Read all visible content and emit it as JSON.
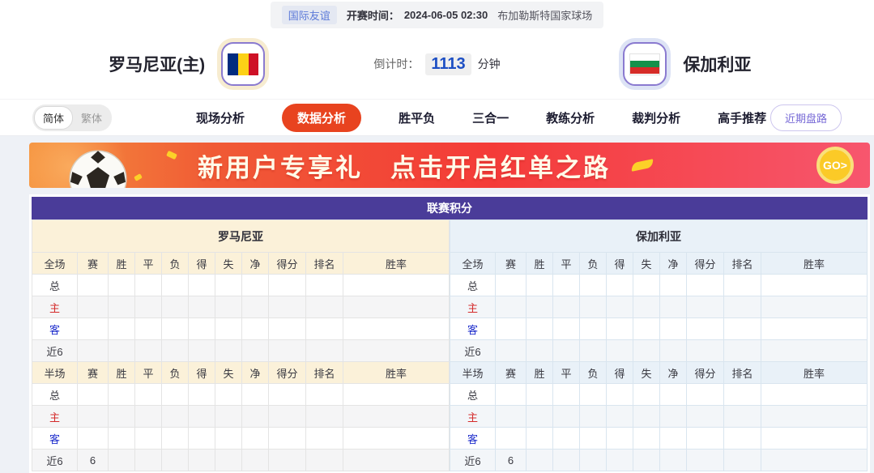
{
  "top_bar": {
    "league_badge": "国际友谊",
    "kickoff_label": "开赛时间：",
    "kickoff_time": "2024-06-05 02:30",
    "venue": "布加勒斯特国家球场"
  },
  "header": {
    "home_team": "罗马尼亚(主)",
    "away_team": "保加利亚",
    "home_flag_icon": "romania-flag-icon",
    "away_flag_icon": "bulgaria-flag-icon",
    "countdown_label": "倒计时：",
    "countdown_value": "1113",
    "countdown_unit": "分钟"
  },
  "nav": {
    "lang_simplified": "简体",
    "lang_traditional": "繁体",
    "tabs": [
      "现场分析",
      "数据分析",
      "胜平负",
      "三合一",
      "教练分析",
      "裁判分析",
      "高手推荐"
    ],
    "active_tab": "数据分析",
    "recent_trends_button": "近期盘路"
  },
  "banner": {
    "title_part1": "新用户专享礼",
    "title_part2": "点击开启红单之路",
    "go_label": "GO>",
    "ball_icon": "soccer-ball-icon"
  },
  "league_table": {
    "title": "联赛积分",
    "columns": [
      "赛",
      "胜",
      "平",
      "负",
      "得",
      "失",
      "净",
      "得分",
      "排名",
      "胜率"
    ],
    "halves": [
      {
        "team": "罗马尼亚",
        "theme": "home",
        "sections": [
          {
            "scope_label": "全场",
            "rows": [
              {
                "label": "总",
                "type": "total",
                "values": [
                  "",
                  "",
                  "",
                  "",
                  "",
                  "",
                  "",
                  "",
                  "",
                  ""
                ]
              },
              {
                "label": "主",
                "type": "home",
                "values": [
                  "",
                  "",
                  "",
                  "",
                  "",
                  "",
                  "",
                  "",
                  "",
                  ""
                ]
              },
              {
                "label": "客",
                "type": "away",
                "values": [
                  "",
                  "",
                  "",
                  "",
                  "",
                  "",
                  "",
                  "",
                  "",
                  ""
                ]
              },
              {
                "label": "近6",
                "type": "recent",
                "values": [
                  "",
                  "",
                  "",
                  "",
                  "",
                  "",
                  "",
                  "",
                  "",
                  ""
                ]
              }
            ]
          },
          {
            "scope_label": "半场",
            "rows": [
              {
                "label": "总",
                "type": "total",
                "values": [
                  "",
                  "",
                  "",
                  "",
                  "",
                  "",
                  "",
                  "",
                  "",
                  ""
                ]
              },
              {
                "label": "主",
                "type": "home",
                "values": [
                  "",
                  "",
                  "",
                  "",
                  "",
                  "",
                  "",
                  "",
                  "",
                  ""
                ]
              },
              {
                "label": "客",
                "type": "away",
                "values": [
                  "",
                  "",
                  "",
                  "",
                  "",
                  "",
                  "",
                  "",
                  "",
                  ""
                ]
              },
              {
                "label": "近6",
                "type": "recent",
                "values": [
                  "6",
                  "",
                  "",
                  "",
                  "",
                  "",
                  "",
                  "",
                  "",
                  ""
                ]
              }
            ]
          }
        ]
      },
      {
        "team": "保加利亚",
        "theme": "away",
        "sections": [
          {
            "scope_label": "全场",
            "rows": [
              {
                "label": "总",
                "type": "total",
                "values": [
                  "",
                  "",
                  "",
                  "",
                  "",
                  "",
                  "",
                  "",
                  "",
                  ""
                ]
              },
              {
                "label": "主",
                "type": "home",
                "values": [
                  "",
                  "",
                  "",
                  "",
                  "",
                  "",
                  "",
                  "",
                  "",
                  ""
                ]
              },
              {
                "label": "客",
                "type": "away",
                "values": [
                  "",
                  "",
                  "",
                  "",
                  "",
                  "",
                  "",
                  "",
                  "",
                  ""
                ]
              },
              {
                "label": "近6",
                "type": "recent",
                "values": [
                  "",
                  "",
                  "",
                  "",
                  "",
                  "",
                  "",
                  "",
                  "",
                  ""
                ]
              }
            ]
          },
          {
            "scope_label": "半场",
            "rows": [
              {
                "label": "总",
                "type": "total",
                "values": [
                  "",
                  "",
                  "",
                  "",
                  "",
                  "",
                  "",
                  "",
                  "",
                  ""
                ]
              },
              {
                "label": "主",
                "type": "home",
                "values": [
                  "",
                  "",
                  "",
                  "",
                  "",
                  "",
                  "",
                  "",
                  "",
                  ""
                ]
              },
              {
                "label": "客",
                "type": "away",
                "values": [
                  "",
                  "",
                  "",
                  "",
                  "",
                  "",
                  "",
                  "",
                  "",
                  ""
                ]
              },
              {
                "label": "近6",
                "type": "recent",
                "values": [
                  "6",
                  "",
                  "",
                  "",
                  "",
                  "",
                  "",
                  "",
                  "",
                  ""
                ]
              }
            ]
          }
        ]
      }
    ]
  },
  "colors": {
    "active_tab_bg": "#e8431f",
    "table_title_bg": "#4a3c99",
    "home_panel_bg": "#fbf1d9",
    "away_panel_bg": "#e9f1f8",
    "countdown_value_blue": "#1d4fc4",
    "row_home_red": "#d42b2b",
    "row_away_blue": "#1f2ecc",
    "go_button_yellow": "#fbca27",
    "recent_button_purple": "#7668d6",
    "league_badge_blue": "#5b79d8"
  }
}
